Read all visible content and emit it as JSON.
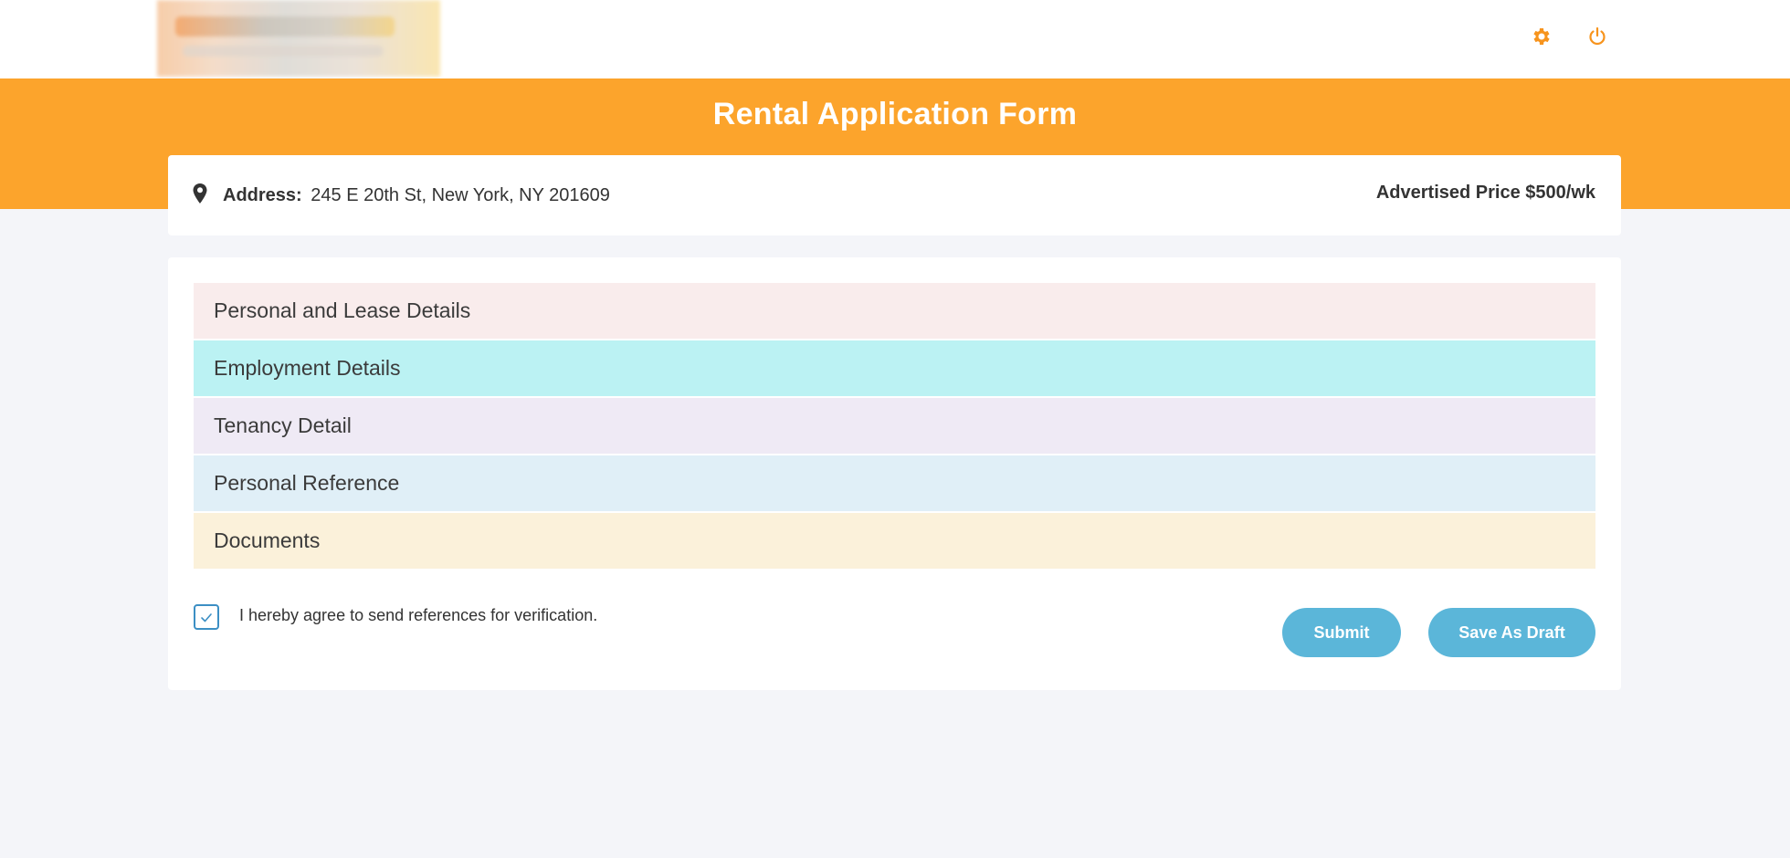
{
  "header": {
    "settings_icon": "gear-icon",
    "power_icon": "power-icon",
    "accent_color": "#f7941d"
  },
  "hero": {
    "title": "Rental Application Form",
    "background_color": "#fca42c"
  },
  "property": {
    "address_label": "Address:",
    "address_value": "245 E 20th St, New York, NY 201609",
    "price_text": "Advertised Price $500/wk",
    "location_icon": "map-pin-icon"
  },
  "sections": [
    {
      "label": "Personal and Lease Details",
      "color": "#f9ecec"
    },
    {
      "label": "Employment Details",
      "color": "#bbf2f3"
    },
    {
      "label": "Tenancy Detail",
      "color": "#efeaf5"
    },
    {
      "label": "Personal Reference",
      "color": "#e0eff7"
    },
    {
      "label": "Documents",
      "color": "#fbf1da"
    }
  ],
  "agreement": {
    "checked": true,
    "text": "I hereby agree to send references for verification."
  },
  "actions": {
    "submit_label": "Submit",
    "draft_label": "Save As Draft",
    "button_color": "#5bb6d9"
  }
}
